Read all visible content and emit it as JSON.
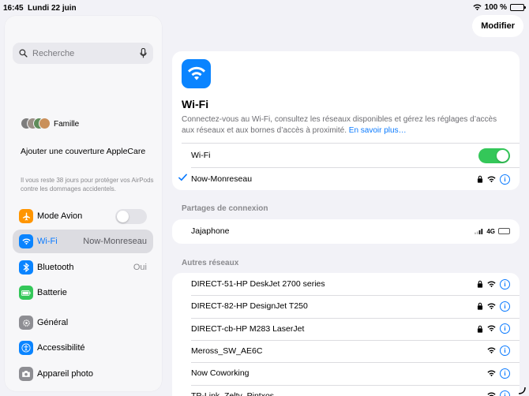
{
  "status": {
    "time": "16:45",
    "date": "Lundi 22 juin",
    "battery": "100 %"
  },
  "sidebar": {
    "search_placeholder": "Recherche",
    "family": "Famille",
    "applecare_title": "Ajouter une couverture AppleCare",
    "applecare_subtitle": "Il vous reste 38 jours pour protéger vos AirPods contre les dommages accidentels.",
    "items": [
      {
        "label": "Mode Avion",
        "value": "",
        "color": "#ff9500",
        "icon": "airplane-icon"
      },
      {
        "label": "Wi-Fi",
        "value": "Now-Monreseau",
        "color": "#0a84ff",
        "icon": "wifi-icon"
      },
      {
        "label": "Bluetooth",
        "value": "Oui",
        "color": "#0a84ff",
        "icon": "bluetooth-icon"
      },
      {
        "label": "Batterie",
        "value": "",
        "color": "#34c759",
        "icon": "battery-icon"
      },
      {
        "label": "Général",
        "value": "",
        "color": "#8e8e93",
        "icon": "gear-icon"
      },
      {
        "label": "Accessibilité",
        "value": "",
        "color": "#0a84ff",
        "icon": "accessibility-icon"
      },
      {
        "label": "Appareil photo",
        "value": "",
        "color": "#8e8e93",
        "icon": "camera-icon"
      }
    ]
  },
  "header": {
    "edit_label": "Modifier"
  },
  "wifi": {
    "title": "Wi-Fi",
    "description": "Connectez-vous au Wi-Fi, consultez les réseaux disponibles et gérez les réglages d’accès aux réseaux et aux bornes d’accès à proximité.",
    "learn_more": "En savoir plus…",
    "toggle_label": "Wi-Fi",
    "toggle_on": true,
    "connected_network": "Now-Monreseau"
  },
  "hotspot": {
    "section_title": "Partages de connexion",
    "device": "Jajaphone",
    "network_type": "4G"
  },
  "other": {
    "section_title": "Autres réseaux",
    "networks": [
      {
        "name": "DIRECT-51-HP DeskJet 2700 series",
        "locked": true
      },
      {
        "name": "DIRECT-82-HP DesignJet T250",
        "locked": true
      },
      {
        "name": "DIRECT-cb-HP M283 LaserJet",
        "locked": true
      },
      {
        "name": "Meross_SW_AE6C",
        "locked": false
      },
      {
        "name": "Now Coworking",
        "locked": false
      },
      {
        "name": "TP-Link_Zelty_Pintxos",
        "locked": false
      }
    ]
  },
  "colors": {
    "accent": "#0a7aff",
    "toggle_on": "#34c759"
  }
}
